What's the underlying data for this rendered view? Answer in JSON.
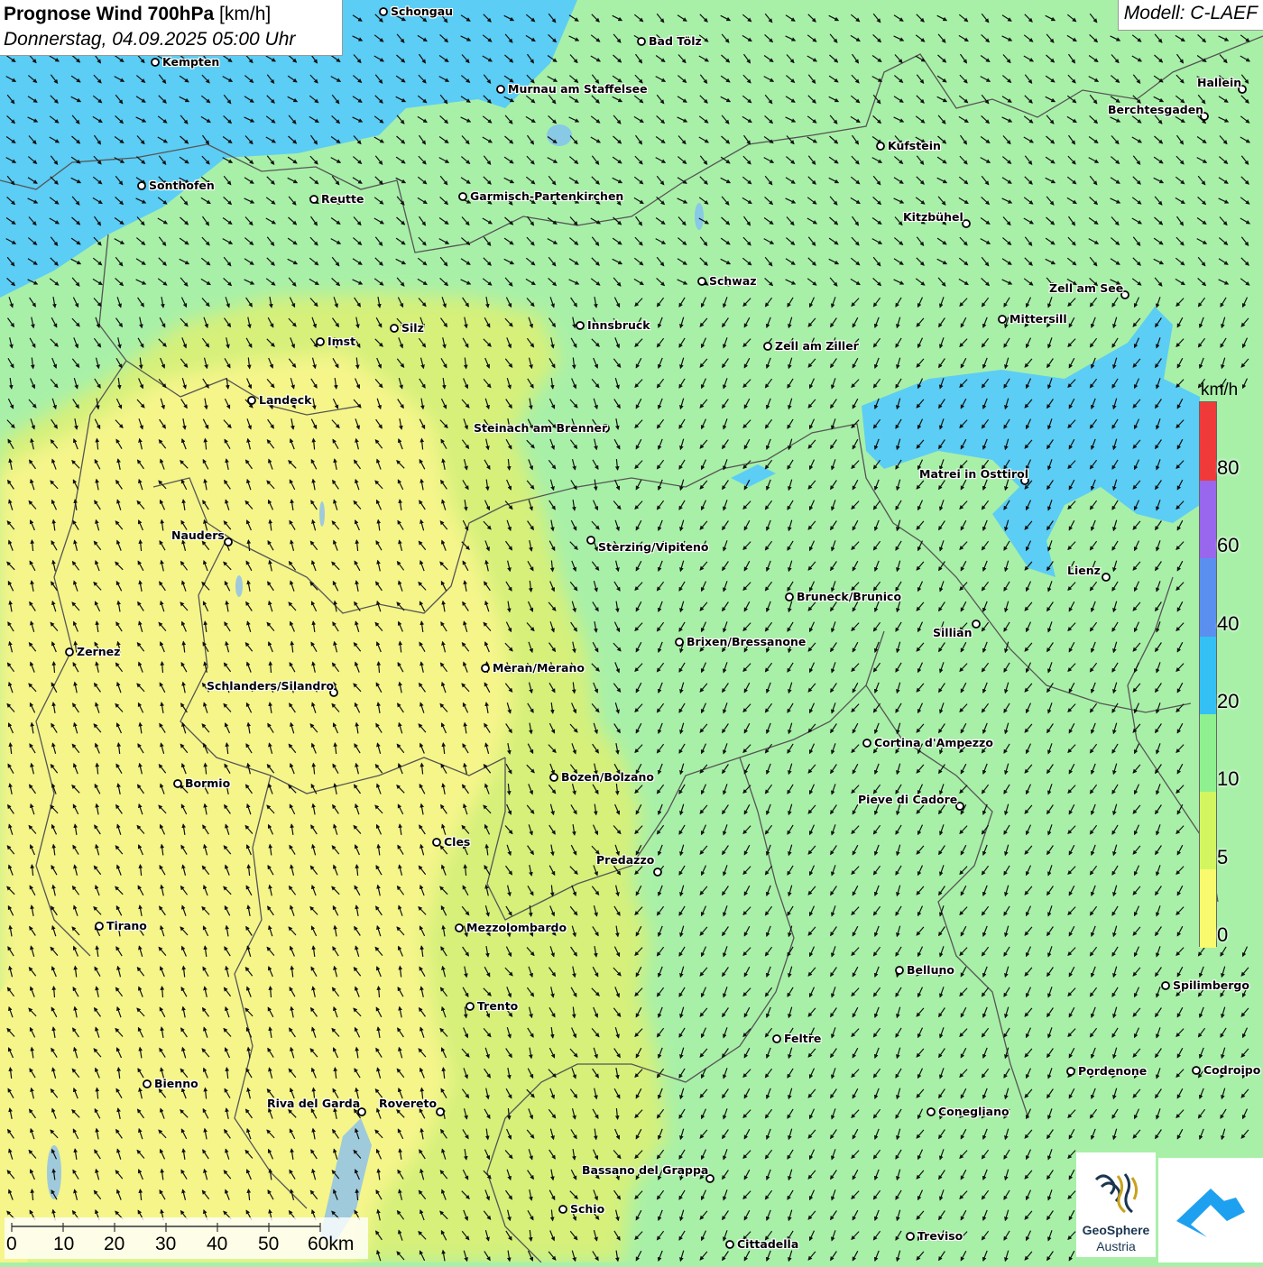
{
  "header": {
    "title_bold": "Prognose Wind 700hPa",
    "title_unit": " [km/h]",
    "datetime": "Donnerstag, 04.09.2025 05:00 Uhr",
    "model": "Modell: C-LAEF"
  },
  "legend": {
    "unit": "km/h",
    "labels": [
      "80",
      "60",
      "40",
      "20",
      "10",
      "5",
      "0"
    ],
    "bands": [
      {
        "color": "#f03a3a"
      },
      {
        "color": "#9966ee"
      },
      {
        "color": "#5a8ff0"
      },
      {
        "color": "#35c0f5"
      },
      {
        "color": "#8ef08e"
      },
      {
        "color": "#d2f560"
      },
      {
        "color": "#fafa6e"
      }
    ]
  },
  "colors": {
    "zone_0_5": "#f5f58a",
    "zone_5_10": "#d6f07a",
    "zone_10_20": "#a8f0a8",
    "zone_20_40": "#5ccdf5",
    "border": "#555555",
    "arrow": "#111111"
  },
  "scale": {
    "labels": [
      "0",
      "10",
      "20",
      "30",
      "40",
      "50",
      "60km"
    ]
  },
  "logos": {
    "geosphere_line1": "GeoSphere",
    "geosphere_line2": "Austria"
  },
  "cities": [
    {
      "name": "Schongau"
    },
    {
      "name": "Bad Tölz"
    },
    {
      "name": "Kempten"
    },
    {
      "name": "Murnau am Staffelsee"
    },
    {
      "name": "Hallein"
    },
    {
      "name": "Berchtesgaden"
    },
    {
      "name": "Kufstein"
    },
    {
      "name": "Sonthofen"
    },
    {
      "name": "Reutte"
    },
    {
      "name": "Garmisch-Partenkirchen"
    },
    {
      "name": "Kitzbühel"
    },
    {
      "name": "Schwaz"
    },
    {
      "name": "Zell am See"
    },
    {
      "name": "Silz"
    },
    {
      "name": "Innsbruck"
    },
    {
      "name": "Mittersill"
    },
    {
      "name": "Imst"
    },
    {
      "name": "Zell am Ziller"
    },
    {
      "name": "Landeck"
    },
    {
      "name": "Steinach am Brenner"
    },
    {
      "name": "Matrei in Osttirol"
    },
    {
      "name": "Nauders"
    },
    {
      "name": "Sterzing/Vipiteno"
    },
    {
      "name": "Lienz"
    },
    {
      "name": "Bruneck/Brunico"
    },
    {
      "name": "Sillian"
    },
    {
      "name": "Brixen/Bressanone"
    },
    {
      "name": "Zernez"
    },
    {
      "name": "Meran/Merano"
    },
    {
      "name": "Schlanders/Silandro"
    },
    {
      "name": "Cortina d'Ampezzo"
    },
    {
      "name": "Bozen/Bolzano"
    },
    {
      "name": "Bormio"
    },
    {
      "name": "Pieve di Cadore"
    },
    {
      "name": "Cles"
    },
    {
      "name": "Predazzo"
    },
    {
      "name": "Tirano"
    },
    {
      "name": "Mezzolombardo"
    },
    {
      "name": "Belluno"
    },
    {
      "name": "Spilimbergo"
    },
    {
      "name": "Trento"
    },
    {
      "name": "Feltre"
    },
    {
      "name": "Pordenone"
    },
    {
      "name": "Codroipo"
    },
    {
      "name": "Bienno"
    },
    {
      "name": "Riva del Garda"
    },
    {
      "name": "Rovereto"
    },
    {
      "name": "Conegliano"
    },
    {
      "name": "Bassano del Grappa"
    },
    {
      "name": "Schio"
    },
    {
      "name": "Treviso"
    },
    {
      "name": "Cittadella"
    }
  ]
}
